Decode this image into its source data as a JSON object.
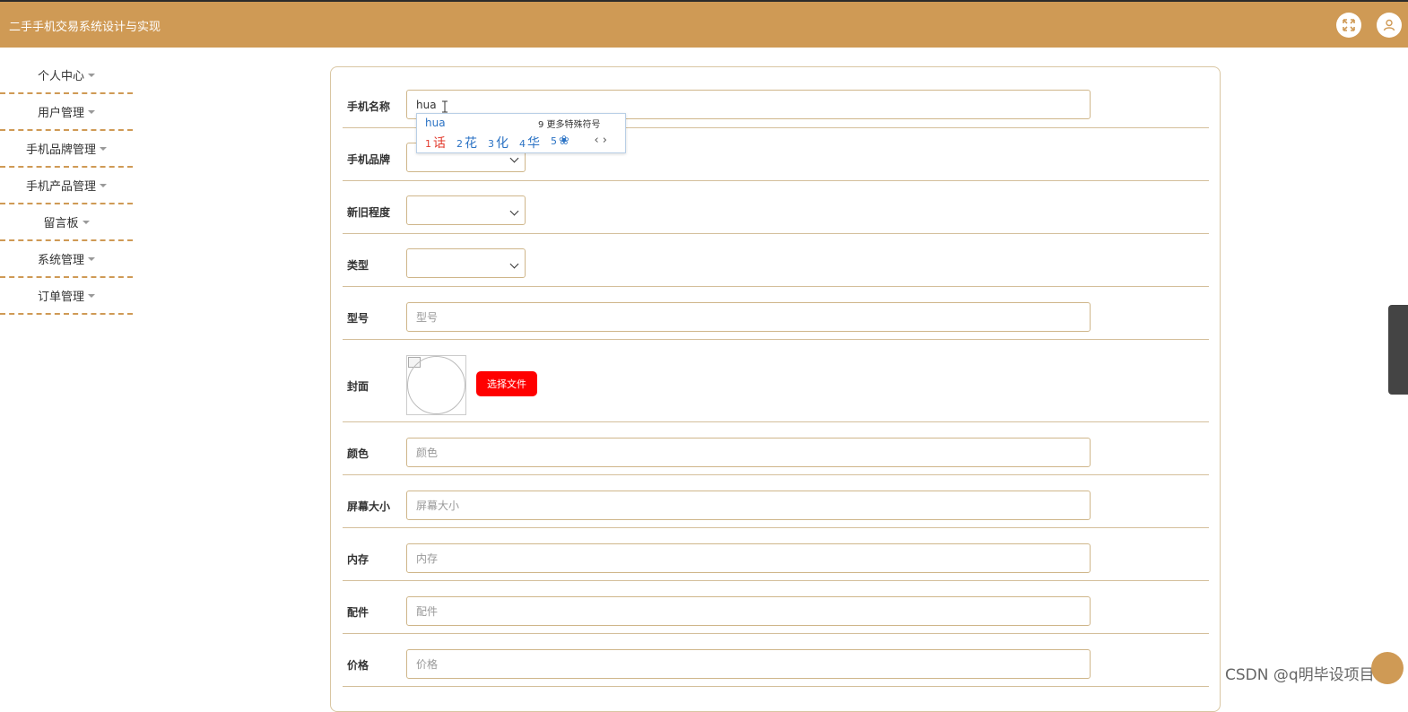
{
  "header": {
    "title": "二手手机交易系统设计与实现"
  },
  "sidebar": {
    "items": [
      {
        "label": "个人中心"
      },
      {
        "label": "用户管理"
      },
      {
        "label": "手机品牌管理"
      },
      {
        "label": "手机产品管理"
      },
      {
        "label": "留言板"
      },
      {
        "label": "系统管理"
      },
      {
        "label": "订单管理"
      }
    ]
  },
  "form": {
    "phone_name": {
      "label": "手机名称",
      "value": "hua"
    },
    "brand": {
      "label": "手机品牌",
      "value": ""
    },
    "condition": {
      "label": "新旧程度",
      "value": ""
    },
    "type": {
      "label": "类型",
      "value": ""
    },
    "model": {
      "label": "型号",
      "placeholder": "型号"
    },
    "cover": {
      "label": "封面",
      "button": "选择文件"
    },
    "color": {
      "label": "颜色",
      "placeholder": "颜色"
    },
    "screen_size": {
      "label": "屏幕大小",
      "placeholder": "屏幕大小"
    },
    "memory": {
      "label": "内存",
      "placeholder": "内存"
    },
    "accessories": {
      "label": "配件",
      "placeholder": "配件"
    },
    "price": {
      "label": "价格",
      "placeholder": "价格"
    }
  },
  "ime": {
    "pinyin": "hua",
    "more": "9 更多特殊符号",
    "candidates": [
      {
        "num": "1",
        "text": "话"
      },
      {
        "num": "2",
        "text": "花"
      },
      {
        "num": "3",
        "text": "化"
      },
      {
        "num": "4",
        "text": "华"
      },
      {
        "num": "5",
        "text": "❀"
      }
    ]
  },
  "watermark": "CSDN @q明毕设项目",
  "colors": {
    "header": "#cf9a55",
    "file_button": "#ff0000",
    "dash": "#cf9a55"
  }
}
